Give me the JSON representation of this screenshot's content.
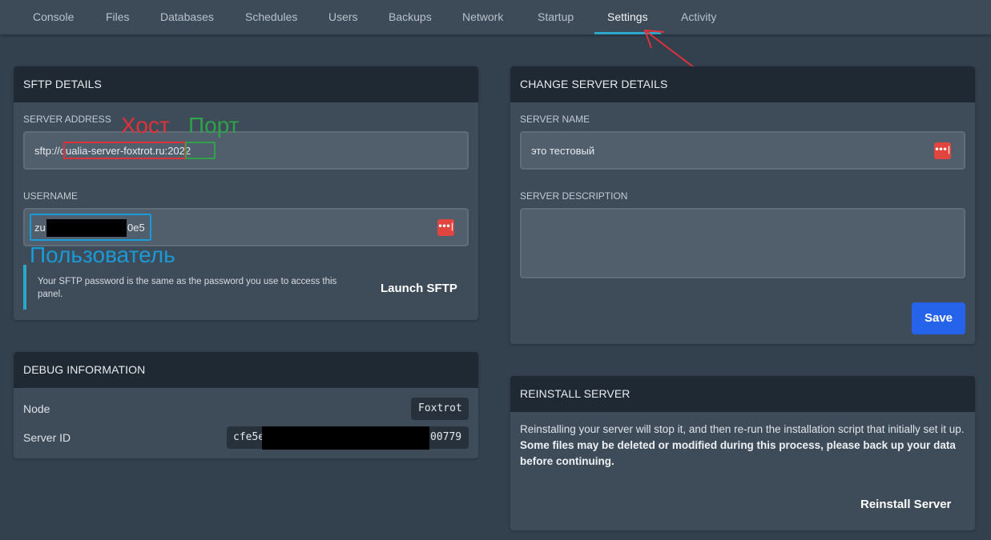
{
  "nav": {
    "tabs": [
      {
        "label": "Console"
      },
      {
        "label": "Files"
      },
      {
        "label": "Databases"
      },
      {
        "label": "Schedules"
      },
      {
        "label": "Users"
      },
      {
        "label": "Backups"
      },
      {
        "label": "Network"
      },
      {
        "label": "Startup"
      },
      {
        "label": "Settings",
        "active": true
      },
      {
        "label": "Activity"
      }
    ]
  },
  "sftp": {
    "title": "SFTP DETAILS",
    "server_address_label": "SERVER ADDRESS",
    "address_prefix": "sftp://",
    "host": "qualia-server-foxtrot.ru",
    "colon": ":",
    "port": "2022",
    "username_label": "USERNAME",
    "username_start": "zu",
    "username_end": "0e5",
    "info_text": "Your SFTP password is the same as the password you use to access this panel.",
    "launch_label": "Launch SFTP"
  },
  "annotations": {
    "host_label": "Хост",
    "port_label": "Порт",
    "user_label": "Пользователь",
    "colors": {
      "host": "#e0323a",
      "port": "#2fa24a",
      "user": "#1a9ad6",
      "arrow": "#e0323a"
    }
  },
  "debug": {
    "title": "DEBUG INFORMATION",
    "node_label": "Node",
    "node_value": "Foxtrot",
    "server_id_label": "Server ID",
    "server_id_start": "cfe5e",
    "server_id_end": "00779"
  },
  "change": {
    "title": "CHANGE SERVER DETAILS",
    "name_label": "SERVER NAME",
    "name_value": "это тестовый",
    "description_label": "SERVER DESCRIPTION",
    "description_value": "",
    "save_label": "Save"
  },
  "reinstall": {
    "title": "REINSTALL SERVER",
    "text_plain": "Reinstalling your server will stop it, and then re-run the installation script that initially set it up. ",
    "text_bold": "Some files may be deleted or modified during this process, please back up your data before continuing.",
    "button_label": "Reinstall Server"
  },
  "theme": {
    "accent": "#2aa7c9",
    "primary_button": "#2563eb",
    "password_toggle": "#e0463f"
  }
}
